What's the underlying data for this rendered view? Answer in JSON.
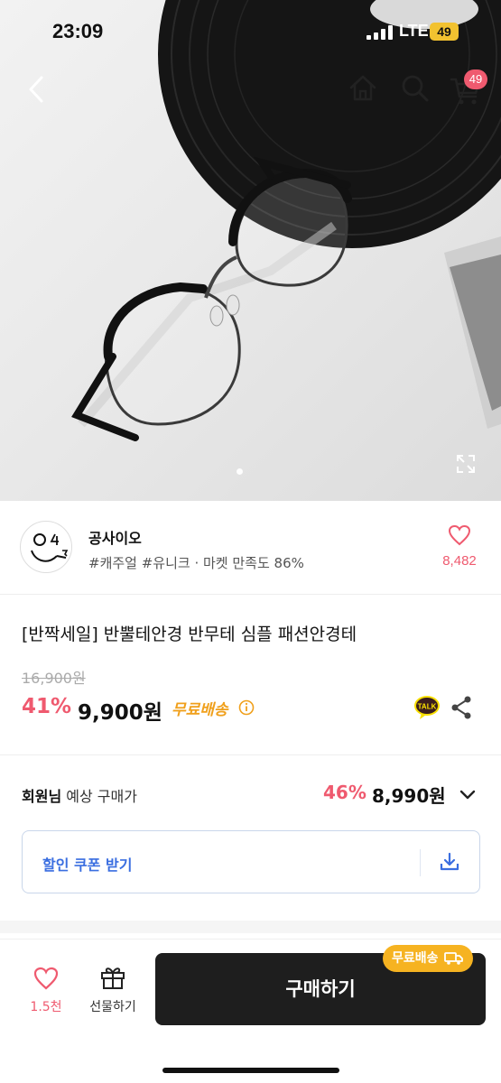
{
  "status_bar": {
    "time": "23:09",
    "network": "LTE",
    "battery": "49"
  },
  "nav": {
    "cart_count": "49"
  },
  "gallery": {
    "current_index": 1
  },
  "shop": {
    "name": "공사이오",
    "meta": "#캐주얼 #유니크 · 마켓 만족도 86%",
    "like_count": "8,482"
  },
  "product": {
    "title": "[반짝세일] 반뿔테안경 반무테 심플 패션안경테",
    "original_price": "16,900원",
    "discount": "41%",
    "price": "9,900원",
    "free_shipping": "무료배송",
    "talk_label": "TALK"
  },
  "member_price": {
    "label_bold": "회원님",
    "label_rest": " 예상 구매가",
    "discount": "46%",
    "price": "8,990원"
  },
  "coupon": {
    "label": "할인 쿠폰 받기"
  },
  "bottom_bar": {
    "like_label": "1.5천",
    "gift_label": "선물하기",
    "buy_label": "구매하기",
    "ship_badge": "무료배송"
  },
  "colors": {
    "accent_pink": "#ef5a6f",
    "coupon_blue": "#3a6ee0",
    "ship_orange": "#f6b321",
    "buy_button": "#1e1e1e"
  }
}
